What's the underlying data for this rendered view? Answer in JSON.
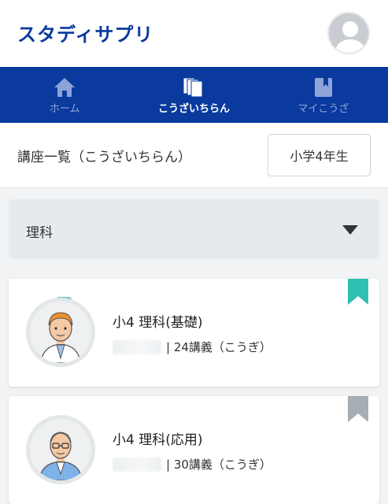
{
  "header": {
    "logo": "スタディサプリ",
    "avatar_icon": "user-avatar-icon"
  },
  "nav": {
    "items": [
      {
        "label": "ホーム",
        "icon": "home-icon",
        "active": false
      },
      {
        "label": "こうざいちらん",
        "icon": "course-list-icon",
        "active": true
      },
      {
        "label": "マイこうざ",
        "icon": "bookmark-book-icon",
        "active": false
      }
    ]
  },
  "page": {
    "title": "講座一覧（こうざいちらん）",
    "grade_button": "小学4年生"
  },
  "filter": {
    "subject": "理科"
  },
  "courses": [
    {
      "title": "小4 理科(基礎)",
      "lectures": "| 24講義（こうぎ）",
      "bookmarked": true,
      "bookmark_color": "#2fbfb3"
    },
    {
      "title": "小4 理科(応用)",
      "lectures": "| 30講義（こうぎ）",
      "bookmarked": false,
      "bookmark_color": "#a6adb3"
    }
  ],
  "colors": {
    "brand": "#0a3a9e",
    "bookmark_active": "#2fbfb3",
    "bookmark_inactive": "#a6adb3"
  }
}
